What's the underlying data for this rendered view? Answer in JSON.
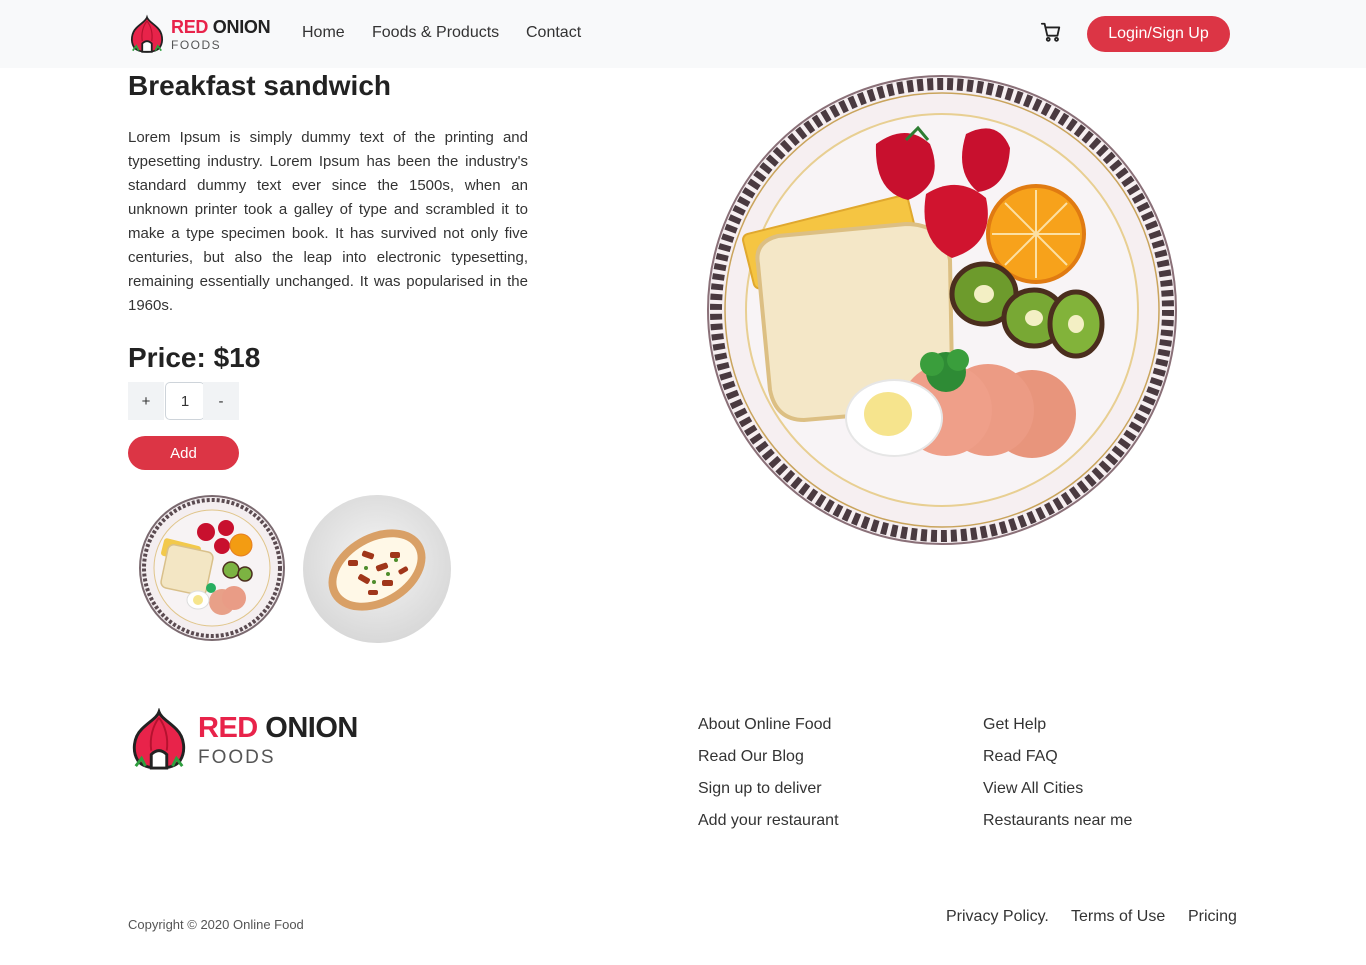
{
  "header": {
    "logo": {
      "brand_primary": "RED ONION",
      "brand_secondary": "FOODS"
    },
    "nav": [
      {
        "label": "Home"
      },
      {
        "label": "Foods & Products"
      },
      {
        "label": "Contact"
      }
    ],
    "cart_icon": "cart-icon",
    "login_label": "Login/Sign Up"
  },
  "product": {
    "title": "Breakfast sandwich",
    "description": "Lorem Ipsum is simply dummy text of the printing and typesetting industry. Lorem Ipsum has been the industry's standard dummy text ever since the 1500s, when an unknown printer took a galley of type and scrambled it to make a type specimen book. It has survived not only five centuries, but also the leap into electronic typesetting, remaining essentially unchanged. It was popularised in the 1960s.",
    "price": "Price: $18",
    "quantity": {
      "plus_label": "+",
      "value": "1",
      "minus_label": "-"
    },
    "add_label": "Add"
  },
  "footer": {
    "logo": {
      "brand_primary": "RED ONION",
      "brand_secondary": "FOODS"
    },
    "col1": [
      {
        "label": "About Online Food"
      },
      {
        "label": "Read Our Blog"
      },
      {
        "label": "Sign up to deliver"
      },
      {
        "label": "Add your restaurant"
      }
    ],
    "col2": [
      {
        "label": "Get Help"
      },
      {
        "label": "Read FAQ"
      },
      {
        "label": "View All Cities"
      },
      {
        "label": "Restaurants near me"
      }
    ],
    "copyright": "Copyright © 2020 Online Food",
    "bottom_links": [
      {
        "label": "Privacy Policy."
      },
      {
        "label": "Terms of Use"
      },
      {
        "label": "Pricing"
      }
    ]
  },
  "colors": {
    "accent": "#dc3545",
    "brand_red": "#e8234a",
    "header_bg": "#f8f9fa"
  }
}
